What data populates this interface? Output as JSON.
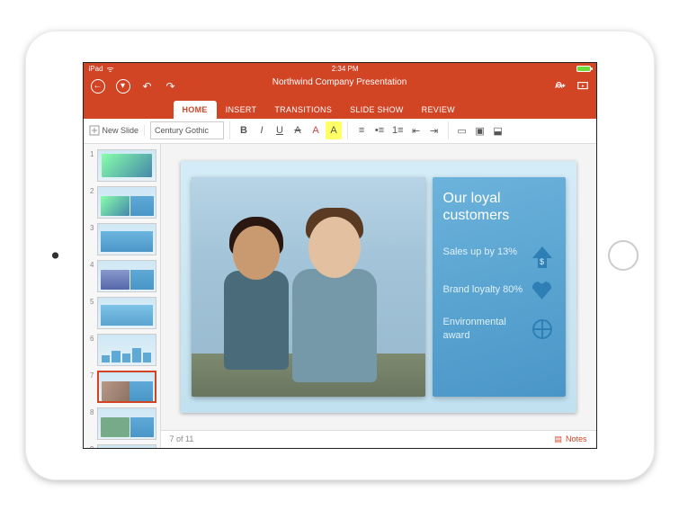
{
  "status": {
    "carrier": "iPad",
    "time": "2:34 PM"
  },
  "doc_title": "Northwind Company Presentation",
  "nav": {
    "undo": "↶",
    "redo": "↷"
  },
  "ribbon": {
    "tabs": [
      "HOME",
      "INSERT",
      "TRANSITIONS",
      "SLIDE SHOW",
      "REVIEW"
    ],
    "active_index": 0
  },
  "toolbar": {
    "new_slide": "New Slide",
    "font_name": "Century Gothic",
    "bold": "B",
    "italic": "I",
    "underline": "U",
    "strike": "A",
    "font_color": "A",
    "highlight": "A",
    "align_left": "≡",
    "bullets": "•≡",
    "numbering": "1≡",
    "indent_dec": "⇤",
    "indent_inc": "⇥",
    "shape": "▭",
    "arrange": "▣",
    "object": "⬓"
  },
  "thumbs": {
    "count": 9,
    "selected_index": 7
  },
  "slide": {
    "panel_title": "Our loyal customers",
    "stats": [
      {
        "text": "Sales up by 13%",
        "icon": "arrow-up-dollar"
      },
      {
        "text": "Brand loyalty 80%",
        "icon": "heart"
      },
      {
        "text": "Environmental award",
        "icon": "globe"
      }
    ]
  },
  "footer": {
    "page_of": "7 of 11",
    "notes": "Notes"
  }
}
